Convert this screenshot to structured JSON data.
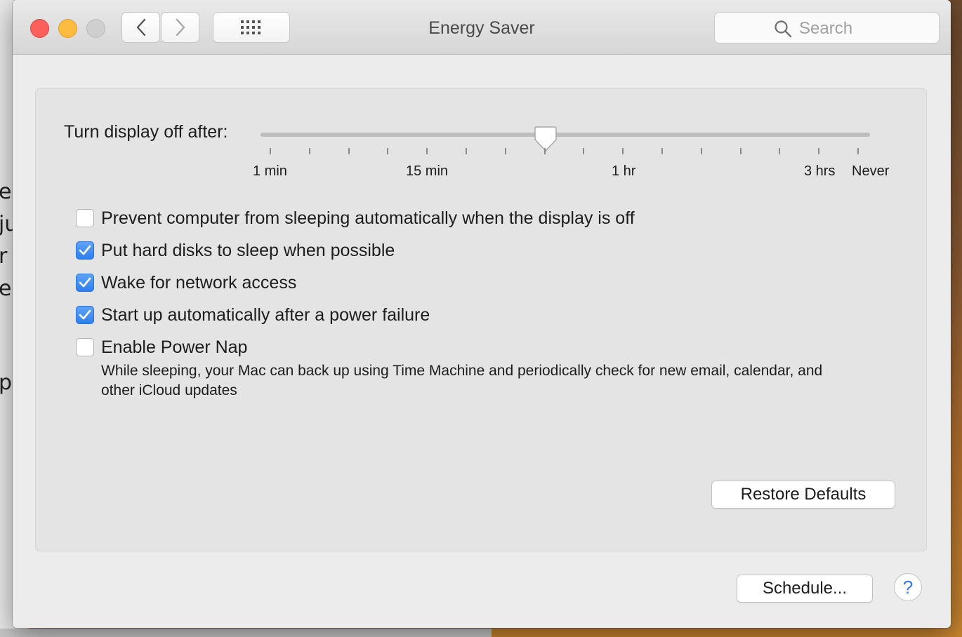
{
  "window": {
    "title": "Energy Saver",
    "search_placeholder": "Search"
  },
  "background_fragments": [
    "e",
    "ju",
    "r",
    "e",
    "p"
  ],
  "slider": {
    "label": "Turn display off after:",
    "tick_labels": [
      "1 min",
      "15 min",
      "1 hr",
      "3 hrs",
      "Never"
    ],
    "tick_count": 16,
    "selected_position_fraction": 0.47
  },
  "options": [
    {
      "label": "Prevent computer from sleeping automatically when the display is off",
      "checked": false
    },
    {
      "label": "Put hard disks to sleep when possible",
      "checked": true
    },
    {
      "label": "Wake for network access",
      "checked": true
    },
    {
      "label": "Start up automatically after a power failure",
      "checked": true
    },
    {
      "label": "Enable Power Nap",
      "checked": false
    }
  ],
  "power_nap_description": "While sleeping, your Mac can back up using Time Machine and periodically check for new email, calendar, and other iCloud updates",
  "buttons": {
    "restore_defaults": "Restore Defaults",
    "schedule": "Schedule...",
    "help": "?"
  },
  "colors": {
    "close": "#fc605c",
    "minimize": "#fdbc40",
    "checkbox_checked": "#2e7ef0",
    "help_accent": "#3478f6"
  }
}
